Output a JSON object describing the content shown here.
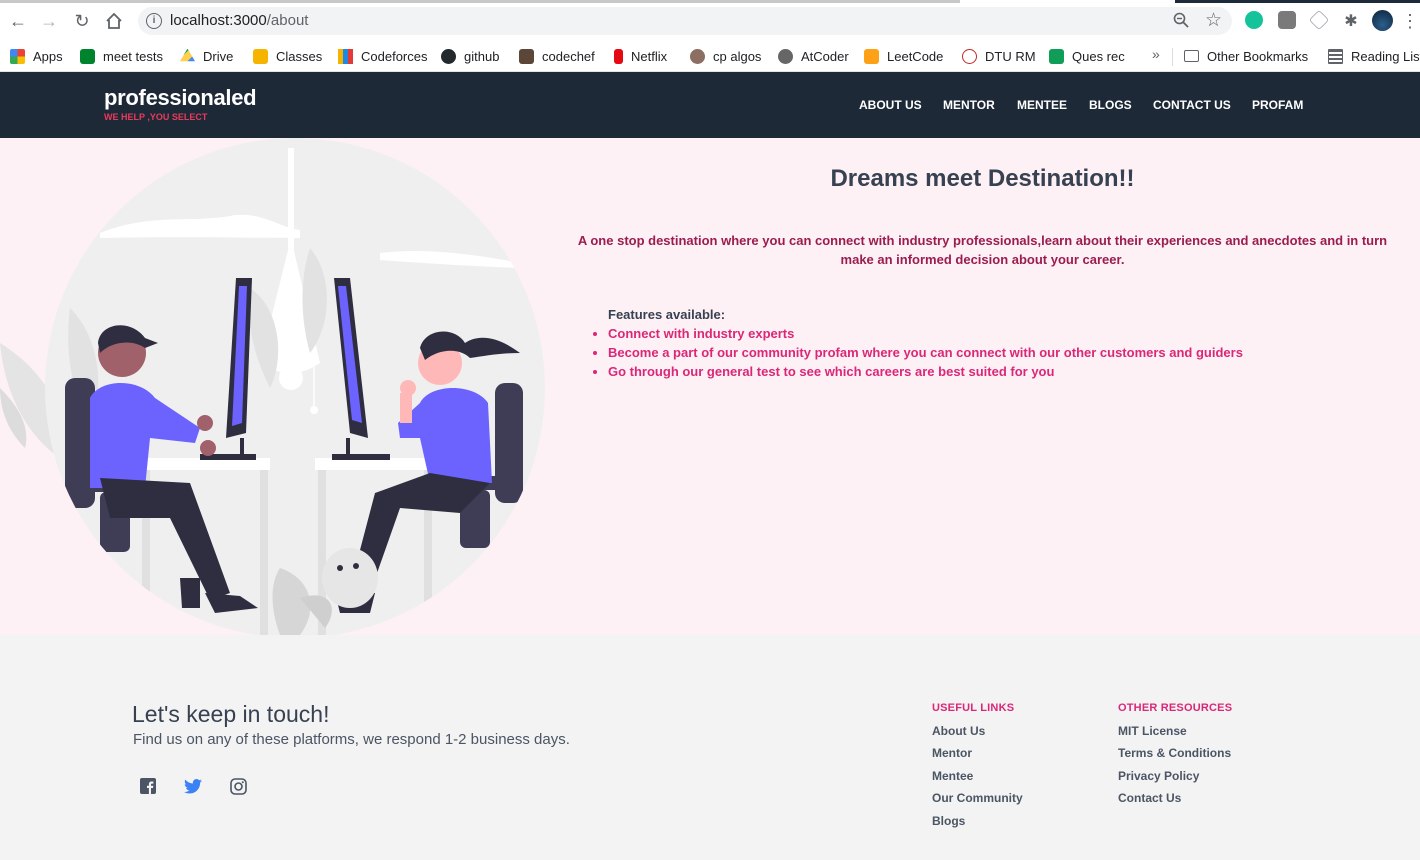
{
  "browser": {
    "url_host": "localhost:3000",
    "url_path": "/about",
    "bookmarks": [
      {
        "label": "Apps",
        "color": "#e8453c"
      },
      {
        "label": "meet tests",
        "color": "#00832d"
      },
      {
        "label": "Drive",
        "color": "#1fa463"
      },
      {
        "label": "Classes",
        "color": "#f4b400"
      },
      {
        "label": "Codeforces",
        "color": "#1e88e5"
      },
      {
        "label": "github",
        "color": "#24292e"
      },
      {
        "label": "codechef",
        "color": "#5b4638"
      },
      {
        "label": "Netflix",
        "color": "#e50914"
      },
      {
        "label": "cp algos",
        "color": "#8d6e63"
      },
      {
        "label": "AtCoder",
        "color": "#666666"
      },
      {
        "label": "LeetCode",
        "color": "#ffa116"
      },
      {
        "label": "DTU RM",
        "color": "#c62828"
      },
      {
        "label": "Ques rec",
        "color": "#0f9d58"
      },
      {
        "label": "Other Bookmarks",
        "color": "#5f6368"
      },
      {
        "label": "Reading List",
        "color": "#5f6368"
      }
    ],
    "more_chevron": "»"
  },
  "header": {
    "brand": "professionaled",
    "tagline": "WE HELP ,YOU SELECT",
    "nav": [
      "ABOUT US",
      "MENTOR",
      "MENTEE",
      "BLOGS",
      "CONTACT US",
      "PROFAM"
    ]
  },
  "hero": {
    "title": "Dreams meet Destination!!",
    "description": "A one stop destination where you can connect with industry professionals,learn about their experiences and anecdotes and in turn make an informed decision about your career.",
    "features_label": "Features available:",
    "features": [
      "Connect with industry experts",
      "Become a part of our community profam where you can connect with our other customers and guiders",
      "Go through our general test to see which careers are best suited for you"
    ]
  },
  "footer": {
    "title": "Let's keep in touch!",
    "subtitle": "Find us on any of these platforms, we respond 1-2 business days.",
    "social": [
      "facebook-icon",
      "twitter-icon",
      "instagram-icon"
    ],
    "useful_links": {
      "heading": "USEFUL LINKS",
      "items": [
        "About Us",
        "Mentor",
        "Mentee",
        "Our Community",
        "Blogs"
      ]
    },
    "other_resources": {
      "heading": "OTHER RESOURCES",
      "items": [
        "MIT License",
        "Terms & Conditions",
        "Privacy Policy",
        "Contact Us"
      ]
    }
  },
  "colors": {
    "header_bg": "#1e2937",
    "hero_bg": "#fdf1f5",
    "accent_pink": "#db2777",
    "desc_maroon": "#9b1c4f",
    "illustration_purple": "#6c63ff"
  }
}
